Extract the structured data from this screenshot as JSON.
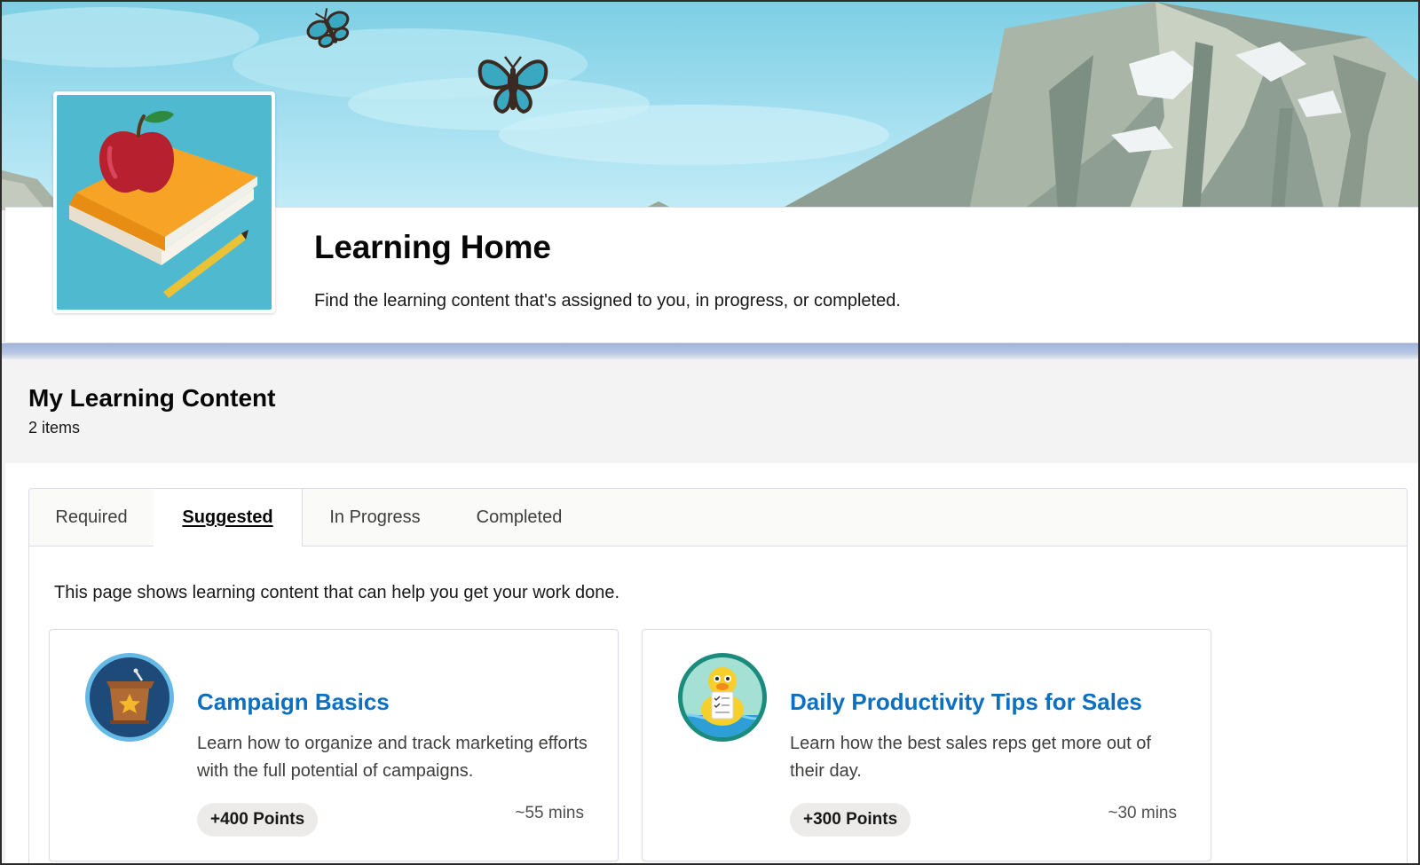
{
  "header": {
    "title": "Learning Home",
    "subtitle": "Find the learning content that's assigned to you, in progress, or completed."
  },
  "section": {
    "title": "My Learning Content",
    "count": "2 items"
  },
  "tabs": [
    {
      "label": "Required",
      "active": false
    },
    {
      "label": "Suggested",
      "active": true
    },
    {
      "label": "In Progress",
      "active": false
    },
    {
      "label": "Completed",
      "active": false
    }
  ],
  "tab_description": "This page shows learning content that can help you get your work done.",
  "cards": [
    {
      "title": "Campaign Basics",
      "description": "Learn how to organize and track marketing efforts with the full potential of campaigns.",
      "points": "+400 Points",
      "duration": "~55 mins",
      "icon": "podium-star-icon"
    },
    {
      "title": "Daily Productivity Tips for Sales",
      "description": "Learn how the best sales reps get more out of their day.",
      "points": "+300 Points",
      "duration": "~30 mins",
      "icon": "duck-checklist-icon"
    }
  ],
  "colors": {
    "link": "#0b6fc2",
    "sky": "#a4dff0",
    "mountain": "#8e9e92",
    "hero_bg": "#4eb9cf"
  }
}
